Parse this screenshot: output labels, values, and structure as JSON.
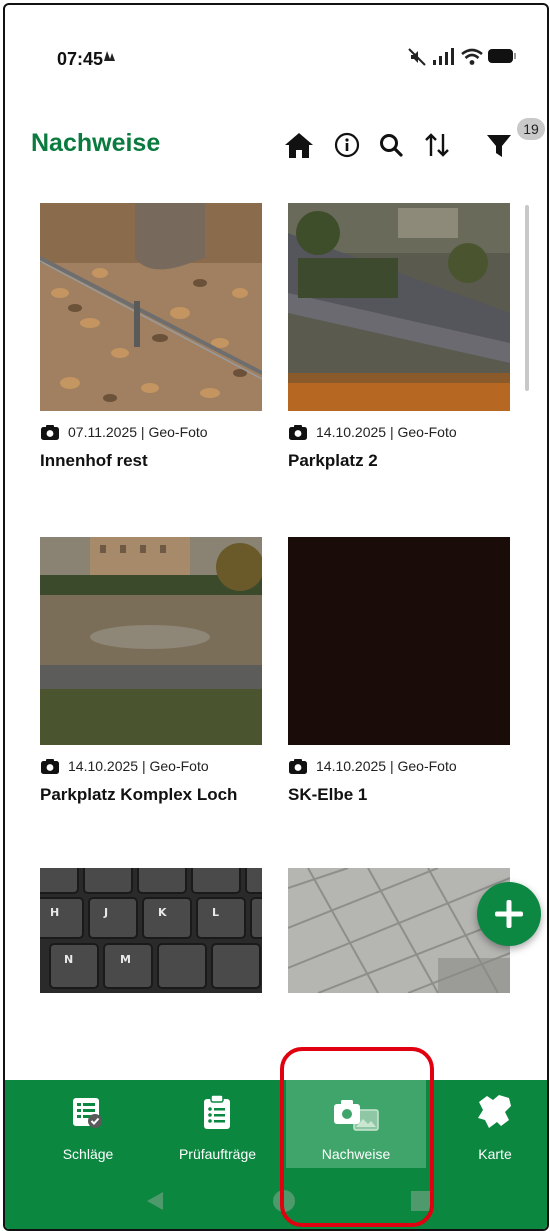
{
  "status_bar": {
    "time": "07:45"
  },
  "header": {
    "title": "Nachweise",
    "filter_count": "19"
  },
  "toolbar_icons": [
    "home-icon",
    "info-icon",
    "search-icon",
    "sort-icon",
    "filter-icon"
  ],
  "cards": [
    {
      "date_type": "07.11.2025 | Geo-Foto",
      "title": "Innenhof rest"
    },
    {
      "date_type": "14.10.2025 | Geo-Foto",
      "title": "Parkplatz 2"
    },
    {
      "date_type": "14.10.2025 | Geo-Foto",
      "title": "Parkplatz Komplex Loch"
    },
    {
      "date_type": "14.10.2025 | Geo-Foto",
      "title": "SK-Elbe 1"
    }
  ],
  "bottom_nav": [
    {
      "label": "Schläge",
      "icon": "fields-list-icon"
    },
    {
      "label": "Prüfaufträge",
      "icon": "clipboard-list-icon"
    },
    {
      "label": "Nachweise",
      "icon": "camera-gallery-icon",
      "active": true
    },
    {
      "label": "Karte",
      "icon": "map-region-icon"
    }
  ],
  "colors": {
    "brand_green": "#0b8740",
    "title_green": "#0a7a3e",
    "active_tab": "#3fa56a",
    "highlight_red": "#e0000f"
  }
}
